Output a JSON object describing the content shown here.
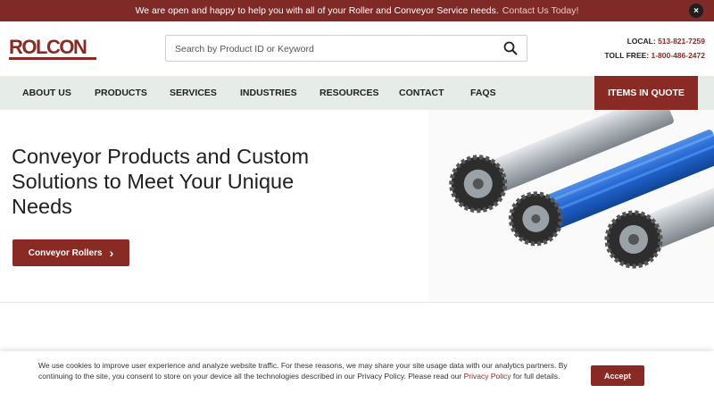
{
  "banner": {
    "message": "We are open and happy to help you with all of your Roller and Conveyor Service needs.",
    "link": "Contact Us Today!",
    "close_icon": "close-icon",
    "close_glyph": "×"
  },
  "brand": {
    "logo_text": "ROLCON",
    "color": "#8a2a25"
  },
  "search": {
    "placeholder": "Search by Product ID or Keyword",
    "icon": "search-icon"
  },
  "contact": {
    "local_label": "LOCAL:",
    "local_number": "513-821-7259",
    "tollfree_label": "TOLL FREE:",
    "tollfree_number": "1-800-486-2472"
  },
  "nav": {
    "items": [
      "ABOUT US",
      "PRODUCTS",
      "SERVICES",
      "INDUSTRIES",
      "RESOURCES",
      "CONTACT",
      "FAQS"
    ],
    "quote": "ITEMS IN QUOTE"
  },
  "hero": {
    "heading": "Conveyor Products and Custom Solutions to Meet Your Unique Needs",
    "button": "Conveyor Rollers",
    "button_glyph": "›"
  },
  "cookie": {
    "text": "We use cookies to improve user experience and analyze website traffic. For these reasons, we may share your site usage data with our analytics partners. By continuing to the site, you consent to store on your device all the technologies described in our Privacy Policy. Please read our",
    "link": "Privacy Policy",
    "suffix": "for full details.",
    "accept": "Accept"
  }
}
